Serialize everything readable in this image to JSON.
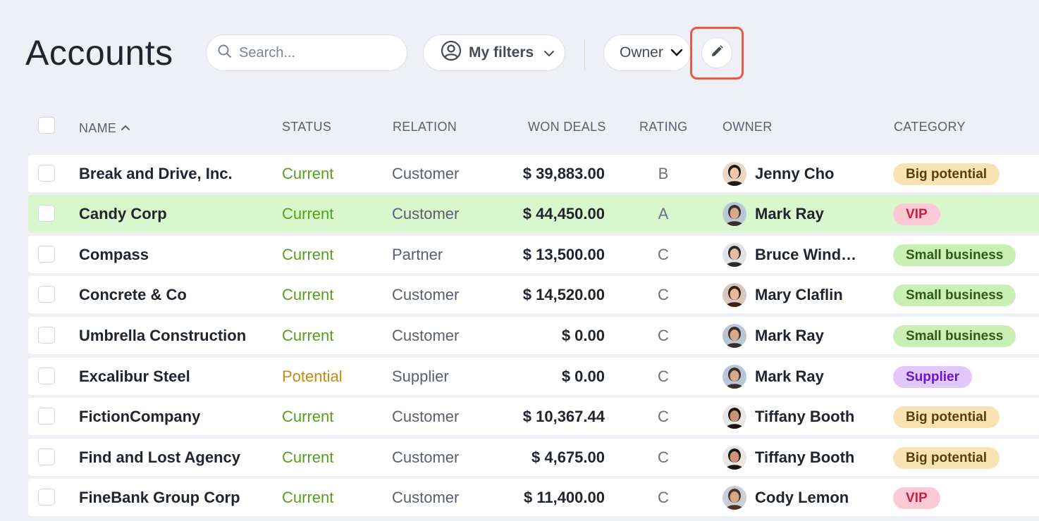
{
  "header": {
    "title": "Accounts",
    "search_placeholder": "Search...",
    "my_filters_label": "My filters",
    "owner_label": "Owner"
  },
  "columns": {
    "name": "NAME",
    "status": "STATUS",
    "relation": "RELATION",
    "won_deals": "WON DEALS",
    "rating": "RATING",
    "owner": "OWNER",
    "category": "CATEGORY"
  },
  "rows": [
    {
      "name": "Break and Drive, Inc.",
      "status": "Current",
      "relation": "Customer",
      "won": "$ 39,883.00",
      "rating": "B",
      "owner": "Jenny Cho",
      "category": "Big potential",
      "highlighted": false
    },
    {
      "name": "Candy Corp",
      "status": "Current",
      "relation": "Customer",
      "won": "$ 44,450.00",
      "rating": "A",
      "owner": "Mark Ray",
      "category": "VIP",
      "highlighted": true
    },
    {
      "name": "Compass",
      "status": "Current",
      "relation": "Partner",
      "won": "$ 13,500.00",
      "rating": "C",
      "owner": "Bruce Windh…",
      "category": "Small business",
      "highlighted": false
    },
    {
      "name": "Concrete & Co",
      "status": "Current",
      "relation": "Customer",
      "won": "$ 14,520.00",
      "rating": "C",
      "owner": "Mary Claflin",
      "category": "Small business",
      "highlighted": false
    },
    {
      "name": "Umbrella Construction",
      "status": "Current",
      "relation": "Customer",
      "won": "$ 0.00",
      "rating": "C",
      "owner": "Mark Ray",
      "category": "Small business",
      "highlighted": false
    },
    {
      "name": "Excalibur Steel",
      "status": "Potential",
      "relation": "Supplier",
      "won": "$ 0.00",
      "rating": "C",
      "owner": "Mark Ray",
      "category": "Supplier",
      "highlighted": false
    },
    {
      "name": "FictionCompany",
      "status": "Current",
      "relation": "Customer",
      "won": "$ 10,367.44",
      "rating": "C",
      "owner": "Tiffany Booth",
      "category": "Big potential",
      "highlighted": false
    },
    {
      "name": "Find and Lost Agency",
      "status": "Current",
      "relation": "Customer",
      "won": "$ 4,675.00",
      "rating": "C",
      "owner": "Tiffany Booth",
      "category": "Big potential",
      "highlighted": false
    },
    {
      "name": "FineBank Group Corp",
      "status": "Current",
      "relation": "Customer",
      "won": "$ 11,400.00",
      "rating": "C",
      "owner": "Cody Lemon",
      "category": "VIP",
      "highlighted": false
    }
  ],
  "colors": {
    "highlight_row": "#d9f7cc",
    "status_current": "#56a01e",
    "status_potential": "#c58a0f",
    "focus_outline": "#e85a44"
  }
}
